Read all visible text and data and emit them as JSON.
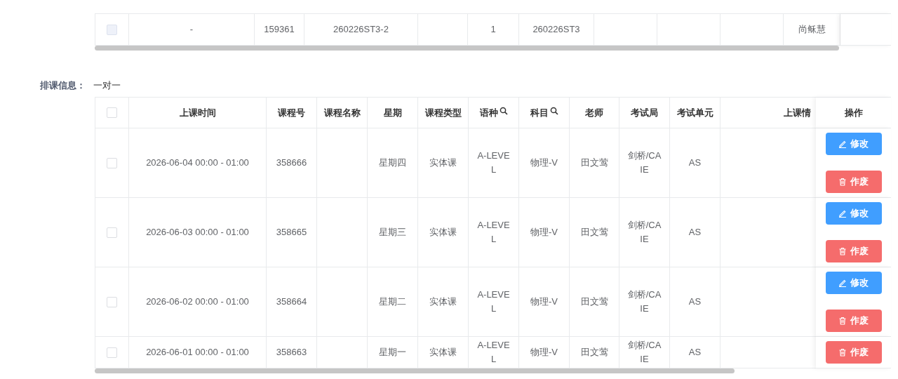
{
  "top_table": {
    "rows": [
      {
        "checkbox": {
          "checked": false,
          "disabled": true
        },
        "cells": [
          "-",
          "159361",
          "260226ST3-2",
          null,
          "1",
          "260226ST3",
          null,
          null,
          null,
          "尚稣慧"
        ]
      }
    ]
  },
  "schedule": {
    "label": "排课信息：",
    "value": "一对一",
    "table": {
      "header_checkbox": {
        "checked": false,
        "disabled": false
      },
      "columns": [
        {
          "label": "上课时间",
          "searchable": false
        },
        {
          "label": "课程号",
          "searchable": false
        },
        {
          "label": "课程名称",
          "searchable": false
        },
        {
          "label": "星期",
          "searchable": false
        },
        {
          "label": "课程类型",
          "searchable": false
        },
        {
          "label": "语种",
          "searchable": true
        },
        {
          "label": "科目",
          "searchable": true
        },
        {
          "label": "老师",
          "searchable": false
        },
        {
          "label": "考试局",
          "searchable": false
        },
        {
          "label": "考试单元",
          "searchable": false
        },
        {
          "label": "上课情",
          "searchable": false
        }
      ],
      "action_header": "操作",
      "rows": [
        {
          "checkbox": {
            "checked": false,
            "disabled": false
          },
          "cells": [
            "2026-06-04 00:00 - 01:00",
            "358666",
            null,
            "星期四",
            "实体课",
            "A-LEVEL",
            "物理-V",
            "田文莺",
            "剑桥/CAIE",
            "AS",
            null
          ],
          "actions": [
            {
              "kind": "edit",
              "label": "修改"
            },
            {
              "kind": "delete",
              "label": "作废"
            }
          ]
        },
        {
          "checkbox": {
            "checked": false,
            "disabled": false
          },
          "cells": [
            "2026-06-03 00:00 - 01:00",
            "358665",
            null,
            "星期三",
            "实体课",
            "A-LEVEL",
            "物理-V",
            "田文莺",
            "剑桥/CAIE",
            "AS",
            null
          ],
          "actions": [
            {
              "kind": "edit",
              "label": "修改"
            },
            {
              "kind": "delete",
              "label": "作废"
            }
          ]
        },
        {
          "checkbox": {
            "checked": false,
            "disabled": false
          },
          "cells": [
            "2026-06-02 00:00 - 01:00",
            "358664",
            null,
            "星期二",
            "实体课",
            "A-LEVEL",
            "物理-V",
            "田文莺",
            "剑桥/CAIE",
            "AS",
            null
          ],
          "actions": [
            {
              "kind": "edit",
              "label": "修改"
            },
            {
              "kind": "delete",
              "label": "作废"
            }
          ]
        },
        {
          "checkbox": {
            "checked": false,
            "disabled": false
          },
          "cells": [
            "2026-06-01 00:00 - 01:00",
            "358663",
            null,
            "星期一",
            "实体课",
            "A-LEVEL",
            "物理-V",
            "田文莺",
            "剑桥/CAIE",
            "AS",
            null
          ],
          "actions": [
            {
              "kind": "delete",
              "label": "作废"
            }
          ]
        }
      ]
    }
  }
}
